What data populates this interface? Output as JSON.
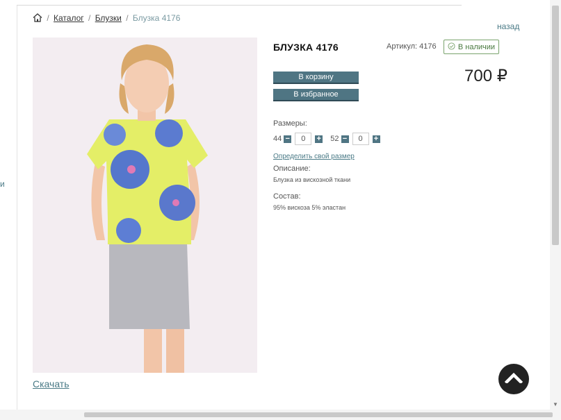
{
  "breadcrumb": {
    "home_icon": "home-icon",
    "separator": "/",
    "catalog": "Каталог",
    "category": "Блузки",
    "current": "Блузка 4176"
  },
  "back_link": "назад",
  "left_cut_text": "и",
  "product": {
    "title": "БЛУЗКА 4176",
    "article": "Артикул: 4176",
    "stock": "В наличии",
    "price": "700 ₽",
    "add_to_cart": "В корзину",
    "add_to_favorites": "В избранное",
    "sizes_label": "Размеры:",
    "sizes": [
      {
        "size": "44",
        "qty": "0"
      },
      {
        "size": "52",
        "qty": "0"
      }
    ],
    "size_link": "Определить свой размер",
    "description_label": "Описание:",
    "description": "Блузка из вискозной ткани",
    "composition_label": "Состав:",
    "composition": "95% вискоза 5% эластан"
  },
  "download_link": "Скачать",
  "colors": {
    "accent": "#4f7583",
    "link": "#4a7a86",
    "stock_green": "#7aa36c"
  }
}
